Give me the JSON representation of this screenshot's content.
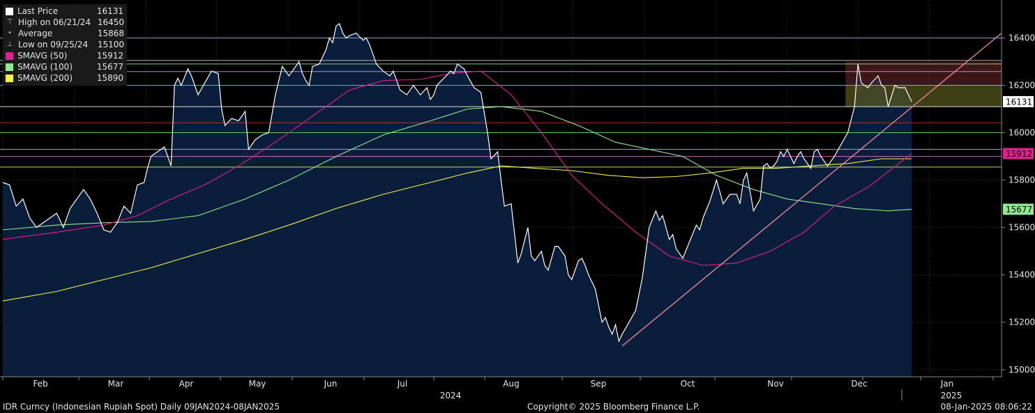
{
  "legend": [
    {
      "name": "Last Price",
      "value": "16131",
      "marker": "square",
      "color": "#ffffff"
    },
    {
      "name": "High on 06/21/24",
      "value": "16450",
      "marker": "high",
      "color": "#bbbbbb"
    },
    {
      "name": "Average",
      "value": "15868",
      "marker": "avg",
      "color": "#bbbbbb"
    },
    {
      "name": "Low on 09/25/24",
      "value": "15100",
      "marker": "low",
      "color": "#bbbbbb"
    },
    {
      "name": "SMAVG (50)",
      "value": "15912",
      "marker": "square",
      "color": "#e0208c"
    },
    {
      "name": "SMAVG (100)",
      "value": "15677",
      "marker": "square",
      "color": "#90e890"
    },
    {
      "name": "SMAVG (200)",
      "value": "15890",
      "marker": "square",
      "color": "#f2f24a"
    }
  ],
  "footer": {
    "left": "IDR Curncy (Indonesian Rupiah Spot)  Daily 09JAN2024-08JAN2025",
    "center": "Copyright© 2025 Bloomberg Finance L.P.",
    "right": "08-Jan-2025 08:06:22"
  },
  "chart_data": {
    "type": "line",
    "ylim": [
      14970,
      16560
    ],
    "yticks": [
      "15000",
      "15200",
      "15400",
      "15600",
      "15800",
      "16000",
      "16200",
      "16400"
    ],
    "x_month_labels": [
      "Feb",
      "Mar",
      "Apr",
      "May",
      "Jun",
      "Jul",
      "Aug",
      "Sep",
      "Oct",
      "Nov",
      "Dec",
      "Jan"
    ],
    "x_year_labels": [
      "2024",
      "2025"
    ],
    "price_label": "16131",
    "price_label_color": "#ffffff",
    "sma50_label": "15912",
    "sma50_color": "#e0208c",
    "sma100_label": "15677",
    "sma100_color": "#90e890",
    "sma200_color": "#f2f24a",
    "price_color": "#ffffff",
    "fill_color": "#0a1e3c",
    "trendline_color": "#f08ca0",
    "horizontal_levels": [
      {
        "y": 16400,
        "color": "#b4b4e6"
      },
      {
        "y": 16305,
        "color": "#d0d0d0"
      },
      {
        "y": 16290,
        "color": "#a0e0a0"
      },
      {
        "y": 16258,
        "color": "#b4b4e6"
      },
      {
        "y": 16200,
        "color": "#80c8e0"
      },
      {
        "y": 16110,
        "color": "#ffffff"
      },
      {
        "y": 16042,
        "color": "#e03030"
      },
      {
        "y": 16000,
        "color": "#80e080"
      },
      {
        "y": 15930,
        "color": "#b4c8f0"
      },
      {
        "y": 15900,
        "color": "#e080e0"
      },
      {
        "y": 15855,
        "color": "#f0f080"
      }
    ],
    "range_boxes": [
      {
        "x0": 0.8438,
        "x1": 1.0,
        "y0": 16200,
        "y1": 16300,
        "color": "#5a1e1e"
      },
      {
        "x0": 0.8438,
        "x1": 1.0,
        "y0": 16110,
        "y1": 16200,
        "color": "#5a5a1e"
      }
    ],
    "price": [
      [
        0.0,
        15790
      ],
      [
        0.0067,
        15780
      ],
      [
        0.0135,
        15690
      ],
      [
        0.0202,
        15720
      ],
      [
        0.027,
        15640
      ],
      [
        0.0337,
        15600
      ],
      [
        0.0404,
        15620
      ],
      [
        0.0472,
        15640
      ],
      [
        0.0539,
        15660
      ],
      [
        0.0573,
        15630
      ],
      [
        0.0607,
        15600
      ],
      [
        0.0674,
        15680
      ],
      [
        0.0741,
        15720
      ],
      [
        0.0809,
        15760
      ],
      [
        0.0876,
        15720
      ],
      [
        0.0944,
        15660
      ],
      [
        0.1011,
        15590
      ],
      [
        0.1078,
        15580
      ],
      [
        0.1146,
        15620
      ],
      [
        0.1213,
        15690
      ],
      [
        0.1281,
        15660
      ],
      [
        0.1348,
        15780
      ],
      [
        0.1415,
        15790
      ],
      [
        0.1449,
        15850
      ],
      [
        0.1483,
        15900
      ],
      [
        0.155,
        15920
      ],
      [
        0.1618,
        15940
      ],
      [
        0.1685,
        15860
      ],
      [
        0.1719,
        16200
      ],
      [
        0.1753,
        16230
      ],
      [
        0.1787,
        16200
      ],
      [
        0.1854,
        16270
      ],
      [
        0.1888,
        16240
      ],
      [
        0.1955,
        16160
      ],
      [
        0.2022,
        16210
      ],
      [
        0.209,
        16260
      ],
      [
        0.2157,
        16250
      ],
      [
        0.2191,
        16100
      ],
      [
        0.2225,
        16030
      ],
      [
        0.2292,
        16060
      ],
      [
        0.236,
        16050
      ],
      [
        0.2427,
        16090
      ],
      [
        0.2461,
        15930
      ],
      [
        0.2528,
        15970
      ],
      [
        0.2596,
        15990
      ],
      [
        0.2663,
        16000
      ],
      [
        0.273,
        16160
      ],
      [
        0.2798,
        16280
      ],
      [
        0.2832,
        16260
      ],
      [
        0.2865,
        16240
      ],
      [
        0.2933,
        16280
      ],
      [
        0.2966,
        16300
      ],
      [
        0.3,
        16250
      ],
      [
        0.3034,
        16220
      ],
      [
        0.3067,
        16200
      ],
      [
        0.3101,
        16280
      ],
      [
        0.3169,
        16290
      ],
      [
        0.3236,
        16350
      ],
      [
        0.327,
        16400
      ],
      [
        0.3303,
        16380
      ],
      [
        0.3337,
        16450
      ],
      [
        0.3371,
        16460
      ],
      [
        0.3404,
        16420
      ],
      [
        0.3438,
        16400
      ],
      [
        0.3472,
        16410
      ],
      [
        0.3539,
        16420
      ],
      [
        0.3607,
        16390
      ],
      [
        0.364,
        16400
      ],
      [
        0.3674,
        16370
      ],
      [
        0.3741,
        16290
      ],
      [
        0.3809,
        16260
      ],
      [
        0.3876,
        16240
      ],
      [
        0.391,
        16260
      ],
      [
        0.3978,
        16180
      ],
      [
        0.4045,
        16160
      ],
      [
        0.4112,
        16200
      ],
      [
        0.418,
        16160
      ],
      [
        0.4247,
        16190
      ],
      [
        0.4281,
        16140
      ],
      [
        0.4315,
        16160
      ],
      [
        0.4348,
        16200
      ],
      [
        0.4416,
        16230
      ],
      [
        0.4483,
        16260
      ],
      [
        0.4517,
        16250
      ],
      [
        0.4551,
        16290
      ],
      [
        0.4618,
        16270
      ],
      [
        0.4652,
        16240
      ],
      [
        0.4719,
        16190
      ],
      [
        0.4787,
        16170
      ],
      [
        0.4854,
        16000
      ],
      [
        0.4888,
        15890
      ],
      [
        0.4955,
        15920
      ],
      [
        0.4989,
        15800
      ],
      [
        0.5022,
        15690
      ],
      [
        0.509,
        15700
      ],
      [
        0.5157,
        15450
      ],
      [
        0.5191,
        15490
      ],
      [
        0.5258,
        15600
      ],
      [
        0.5292,
        15480
      ],
      [
        0.5326,
        15460
      ],
      [
        0.5393,
        15500
      ],
      [
        0.5427,
        15440
      ],
      [
        0.5461,
        15420
      ],
      [
        0.5528,
        15520
      ],
      [
        0.5562,
        15520
      ],
      [
        0.5629,
        15480
      ],
      [
        0.5663,
        15400
      ],
      [
        0.5697,
        15380
      ],
      [
        0.5764,
        15460
      ],
      [
        0.5798,
        15470
      ],
      [
        0.5831,
        15440
      ],
      [
        0.5865,
        15400
      ],
      [
        0.5933,
        15340
      ],
      [
        0.6,
        15200
      ],
      [
        0.6034,
        15220
      ],
      [
        0.6067,
        15180
      ],
      [
        0.6101,
        15150
      ],
      [
        0.6135,
        15190
      ],
      [
        0.6169,
        15120
      ],
      [
        0.6202,
        15150
      ],
      [
        0.627,
        15200
      ],
      [
        0.6337,
        15250
      ],
      [
        0.6404,
        15390
      ],
      [
        0.6472,
        15600
      ],
      [
        0.6539,
        15670
      ],
      [
        0.6573,
        15630
      ],
      [
        0.6607,
        15650
      ],
      [
        0.6674,
        15550
      ],
      [
        0.6708,
        15570
      ],
      [
        0.6742,
        15510
      ],
      [
        0.6809,
        15470
      ],
      [
        0.6876,
        15540
      ],
      [
        0.6944,
        15610
      ],
      [
        0.6978,
        15590
      ],
      [
        0.7011,
        15640
      ],
      [
        0.7079,
        15710
      ],
      [
        0.7146,
        15800
      ],
      [
        0.718,
        15750
      ],
      [
        0.7213,
        15700
      ],
      [
        0.7281,
        15740
      ],
      [
        0.7348,
        15740
      ],
      [
        0.7382,
        15700
      ],
      [
        0.7416,
        15800
      ],
      [
        0.7449,
        15830
      ],
      [
        0.7517,
        15670
      ],
      [
        0.7584,
        15720
      ],
      [
        0.7618,
        15860
      ],
      [
        0.7652,
        15870
      ],
      [
        0.7685,
        15850
      ],
      [
        0.7719,
        15860
      ],
      [
        0.7753,
        15880
      ],
      [
        0.7787,
        15920
      ],
      [
        0.782,
        15900
      ],
      [
        0.7854,
        15930
      ],
      [
        0.7921,
        15870
      ],
      [
        0.7955,
        15900
      ],
      [
        0.7989,
        15920
      ],
      [
        0.8022,
        15890
      ],
      [
        0.809,
        15850
      ],
      [
        0.8124,
        15920
      ],
      [
        0.8157,
        15930
      ],
      [
        0.8191,
        15900
      ],
      [
        0.8258,
        15860
      ],
      [
        0.8292,
        15880
      ],
      [
        0.8326,
        15900
      ],
      [
        0.8393,
        15950
      ],
      [
        0.8461,
        16000
      ],
      [
        0.8528,
        16110
      ],
      [
        0.8562,
        16290
      ],
      [
        0.8596,
        16210
      ],
      [
        0.8663,
        16190
      ],
      [
        0.8697,
        16210
      ],
      [
        0.8764,
        16240
      ],
      [
        0.8798,
        16200
      ],
      [
        0.8831,
        16190
      ],
      [
        0.8865,
        16110
      ],
      [
        0.8933,
        16200
      ],
      [
        0.8966,
        16190
      ],
      [
        0.9034,
        16190
      ],
      [
        0.9101,
        16131
      ]
    ],
    "sma50": [
      [
        0.0,
        15550
      ],
      [
        0.0539,
        15580
      ],
      [
        0.1011,
        15610
      ],
      [
        0.1348,
        15650
      ],
      [
        0.1685,
        15720
      ],
      [
        0.2022,
        15780
      ],
      [
        0.236,
        15860
      ],
      [
        0.273,
        15960
      ],
      [
        0.3101,
        16070
      ],
      [
        0.3472,
        16180
      ],
      [
        0.3809,
        16220
      ],
      [
        0.418,
        16225
      ],
      [
        0.4483,
        16250
      ],
      [
        0.4787,
        16260
      ],
      [
        0.509,
        16160
      ],
      [
        0.5393,
        16000
      ],
      [
        0.5697,
        15820
      ],
      [
        0.6,
        15700
      ],
      [
        0.6337,
        15580
      ],
      [
        0.6674,
        15480
      ],
      [
        0.7011,
        15440
      ],
      [
        0.7348,
        15450
      ],
      [
        0.7685,
        15500
      ],
      [
        0.8022,
        15580
      ],
      [
        0.8326,
        15690
      ],
      [
        0.8663,
        15770
      ],
      [
        0.9101,
        15912
      ]
    ],
    "sma100": [
      [
        0.0,
        15590
      ],
      [
        0.0539,
        15610
      ],
      [
        0.1011,
        15620
      ],
      [
        0.1483,
        15625
      ],
      [
        0.1955,
        15650
      ],
      [
        0.2427,
        15720
      ],
      [
        0.2865,
        15800
      ],
      [
        0.3337,
        15900
      ],
      [
        0.3809,
        15990
      ],
      [
        0.4281,
        16050
      ],
      [
        0.4652,
        16100
      ],
      [
        0.4989,
        16110
      ],
      [
        0.5393,
        16090
      ],
      [
        0.5764,
        16030
      ],
      [
        0.6135,
        15960
      ],
      [
        0.6472,
        15930
      ],
      [
        0.6809,
        15900
      ],
      [
        0.7146,
        15820
      ],
      [
        0.7517,
        15760
      ],
      [
        0.7854,
        15720
      ],
      [
        0.8191,
        15700
      ],
      [
        0.8528,
        15680
      ],
      [
        0.8865,
        15670
      ],
      [
        0.9101,
        15677
      ]
    ],
    "sma200": [
      [
        0.0,
        15290
      ],
      [
        0.0539,
        15330
      ],
      [
        0.1011,
        15380
      ],
      [
        0.1483,
        15430
      ],
      [
        0.1955,
        15490
      ],
      [
        0.2427,
        15550
      ],
      [
        0.2865,
        15610
      ],
      [
        0.3337,
        15680
      ],
      [
        0.3809,
        15740
      ],
      [
        0.4281,
        15790
      ],
      [
        0.4652,
        15830
      ],
      [
        0.4989,
        15860
      ],
      [
        0.5326,
        15850
      ],
      [
        0.5697,
        15840
      ],
      [
        0.6067,
        15820
      ],
      [
        0.6404,
        15810
      ],
      [
        0.6742,
        15815
      ],
      [
        0.7079,
        15830
      ],
      [
        0.7416,
        15850
      ],
      [
        0.7753,
        15850
      ],
      [
        0.809,
        15860
      ],
      [
        0.8461,
        15870
      ],
      [
        0.8798,
        15890
      ],
      [
        0.9101,
        15890
      ]
    ],
    "trendline": [
      [
        0.6202,
        15100
      ],
      [
        1.0,
        16420
      ]
    ]
  }
}
